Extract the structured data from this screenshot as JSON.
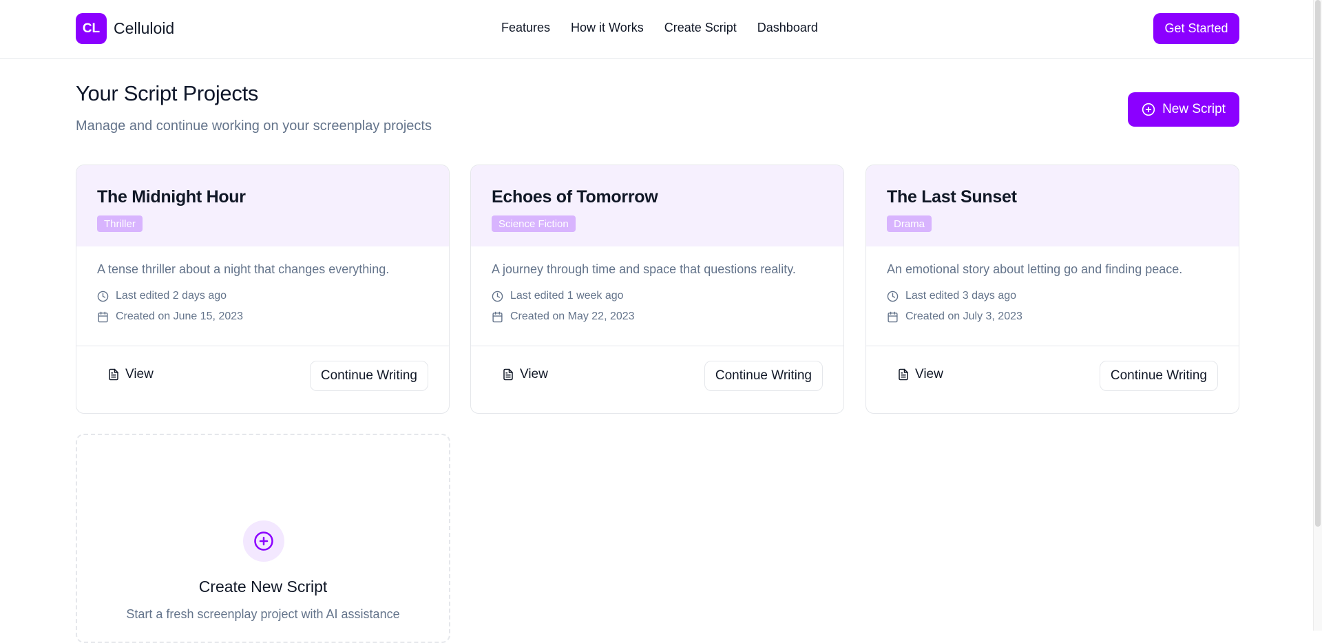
{
  "brand": {
    "badge": "CL",
    "name": "Celluloid"
  },
  "nav": [
    {
      "label": "Features"
    },
    {
      "label": "How it Works"
    },
    {
      "label": "Create Script"
    },
    {
      "label": "Dashboard"
    }
  ],
  "header": {
    "cta_label": "Get Started"
  },
  "page": {
    "title": "Your Script Projects",
    "subtitle": "Manage and continue working on your screenplay projects",
    "new_script_label": "New Script"
  },
  "projects": [
    {
      "title": "The Midnight Hour",
      "genre": "Thriller",
      "description": "A tense thriller about a night that changes everything.",
      "last_edited": "Last edited 2 days ago",
      "created": "Created on June 15, 2023",
      "view_label": "View",
      "continue_label": "Continue Writing"
    },
    {
      "title": "Echoes of Tomorrow",
      "genre": "Science Fiction",
      "description": "A journey through time and space that questions reality.",
      "last_edited": "Last edited 1 week ago",
      "created": "Created on May 22, 2023",
      "view_label": "View",
      "continue_label": "Continue Writing"
    },
    {
      "title": "The Last Sunset",
      "genre": "Drama",
      "description": "An emotional story about letting go and finding peace.",
      "last_edited": "Last edited 3 days ago",
      "created": "Created on July 3, 2023",
      "view_label": "View",
      "continue_label": "Continue Writing"
    }
  ],
  "create_card": {
    "title": "Create New Script",
    "subtitle": "Start a fresh screenplay project with AI assistance"
  },
  "colors": {
    "accent": "#8b00ff",
    "card_header_bg": "#f6f0fe",
    "tag_bg": "#d8b4fe",
    "muted_text": "#64748b",
    "border": "#e5e7eb"
  },
  "icons": {
    "new_script": "plus-circle-icon",
    "last_edited": "clock-icon",
    "created": "calendar-icon",
    "view": "file-text-icon",
    "create_card": "plus-circle-icon"
  }
}
